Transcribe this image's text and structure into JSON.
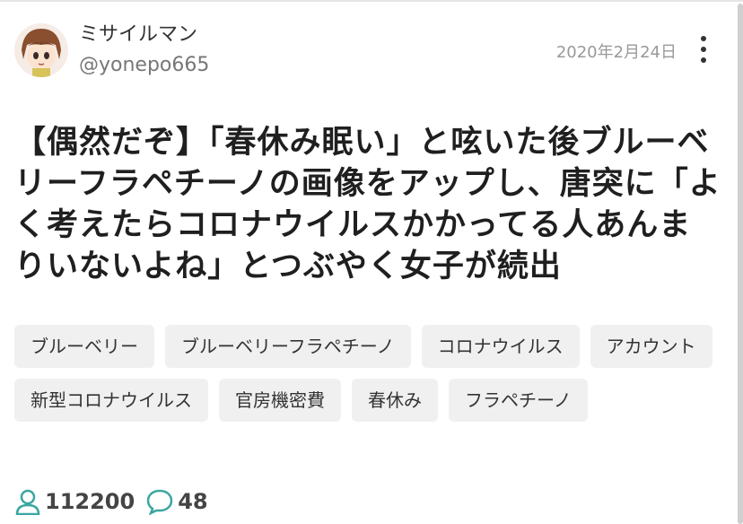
{
  "post": {
    "author_name": "ミサイルマン",
    "author_handle": "@yonepo665",
    "date": "2020年2月24日",
    "title": "【偶然だぞ】「春休み眠い」と呟いた後ブルーベリーフラペチーノの画像をアップし、唐突に「よく考えたらコロナウイルスかかってる人あんまりいないよね」とつぶやく女子が続出"
  },
  "tags": [
    {
      "label": "ブルーベリー"
    },
    {
      "label": "ブルーベリーフラペチーノ"
    },
    {
      "label": "コロナウイルス"
    },
    {
      "label": "アカウント"
    },
    {
      "label": "新型コロナウイルス"
    },
    {
      "label": "官房機密費"
    },
    {
      "label": "春休み"
    },
    {
      "label": "フラペチーノ"
    }
  ],
  "stats": {
    "views": "112200",
    "comments": "48"
  },
  "icons": {
    "user_icon": "user-outline-icon",
    "comment_icon": "speech-bubble-icon",
    "menu_icon": "kebab-menu-icon",
    "accent_color": "#3aa6a0"
  }
}
